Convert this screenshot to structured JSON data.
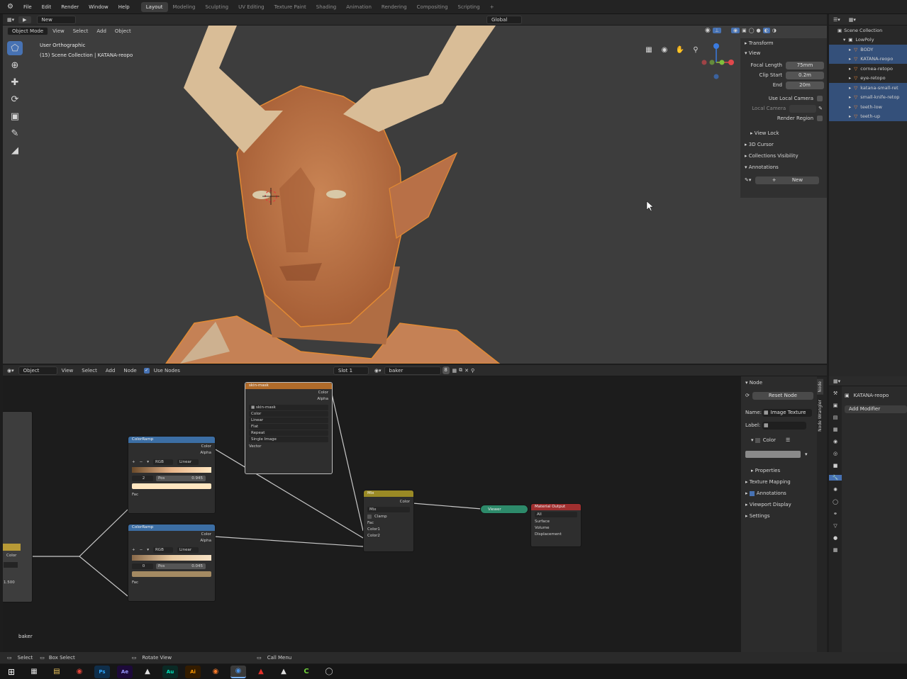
{
  "menubar": {
    "items": [
      "File",
      "Edit",
      "Render",
      "Window",
      "Help"
    ],
    "workspaces": [
      "Layout",
      "Modeling",
      "Sculpting",
      "UV Editing",
      "Texture Paint",
      "Shading",
      "Animation",
      "Rendering",
      "Compositing",
      "Scripting"
    ],
    "active_workspace": "Layout",
    "add_tab": "+"
  },
  "toolbar_top": {
    "new_label": "New",
    "transform_orientation": "Global"
  },
  "viewport": {
    "mode": "Object Mode",
    "menus": [
      "View",
      "Select",
      "Add",
      "Object"
    ],
    "view_name": "User Orthographic",
    "collection_info": "(15) Scene Collection | KATANA-reopo"
  },
  "npanel": {
    "transform": "Transform",
    "view": "View",
    "focal_length_label": "Focal Length",
    "focal_length_value": "75mm",
    "clip_start_label": "Clip Start",
    "clip_start_value": "0.2m",
    "end_label": "End",
    "end_value": "20m",
    "use_local_camera": "Use Local Camera",
    "local_camera": "Local Camera",
    "render_region": "Render Region",
    "view_lock": "View Lock",
    "cursor_3d": "3D Cursor",
    "collections_visibility": "Collections Visibility",
    "annotations": "Annotations",
    "new_button": "New"
  },
  "outliner": {
    "scene_collection": "Scene Collection",
    "items": [
      {
        "name": "LowPoly",
        "selected": false
      },
      {
        "name": "BODY",
        "selected": true
      },
      {
        "name": "KATANA-reopo",
        "selected": true
      },
      {
        "name": "cornea-retopo",
        "selected": false
      },
      {
        "name": "eye-retopo",
        "selected": false
      },
      {
        "name": "katana-small-ret",
        "selected": true
      },
      {
        "name": "small-knife-retop",
        "selected": true
      },
      {
        "name": "teeth-low",
        "selected": true
      },
      {
        "name": "teeth-up",
        "selected": true
      }
    ]
  },
  "node_header": {
    "object": "Object",
    "menus": [
      "View",
      "Select",
      "Add",
      "Node"
    ],
    "use_nodes": "Use Nodes",
    "slot": "Slot 1",
    "material": "baker",
    "users": "8"
  },
  "nodes": {
    "image_texture": {
      "title": "skin-mask",
      "out_color": "Color",
      "out_alpha": "Alpha",
      "image_name": "skin-mask",
      "options": [
        "Color",
        "Linear",
        "Flat",
        "Repeat",
        "Single Image"
      ],
      "in_vector": "Vector"
    },
    "colorramp1": {
      "title": "ColorRamp",
      "out_color": "Color",
      "out_alpha": "Alpha",
      "mode": "RGB",
      "interp": "Linear",
      "index": "2",
      "pos_label": "Pos",
      "pos_value": "0.945",
      "in_fac": "Fac"
    },
    "colorramp2": {
      "title": "ColorRamp",
      "out_color": "Color",
      "out_alpha": "Alpha",
      "mode": "RGB",
      "interp": "Linear",
      "index": "0",
      "pos_label": "Pos",
      "pos_value": "0.045",
      "in_fac": "Fac"
    },
    "mix": {
      "title": "Mix",
      "out_color": "Color",
      "blend": "Mix",
      "clamp": "Clamp",
      "in_fac": "Fac",
      "in_color1": "Color1",
      "in_color2": "Color2"
    },
    "viewer": {
      "title": "Viewer"
    },
    "material_output": {
      "title": "Material Output",
      "target": "All",
      "in_surface": "Surface",
      "in_volume": "Volume",
      "in_displacement": "Displacement"
    },
    "left_node": {
      "out_color": "Color",
      "value": "1.500"
    },
    "material_label": "baker"
  },
  "node_sidebar": {
    "node_header": "Node",
    "reset_node": "Reset Node",
    "name_label": "Name:",
    "name_value": "Image Texture",
    "label_label": "Label:",
    "color_label": "Color",
    "properties": "Properties",
    "sections": [
      "Texture Mapping",
      "Annotations",
      "Viewport Display",
      "Settings"
    ],
    "tabs": [
      "Node",
      "Node Wrangler"
    ]
  },
  "properties_editor": {
    "object_name": "KATANA-reopo",
    "add_modifier": "Add Modifier"
  },
  "statusbar": {
    "select": "Select",
    "box_select": "Box Select",
    "rotate_view": "Rotate View",
    "call_menu": "Call Menu"
  },
  "colors": {
    "accent_blue": "#4772b3",
    "selection_orange": "#e28a33",
    "colorramp_header": "#3c6ea4",
    "texture_header": "#b06b2a",
    "mix_header": "#9a8a25",
    "viewer_green": "#2d8a6a",
    "output_red": "#a02f2f"
  }
}
